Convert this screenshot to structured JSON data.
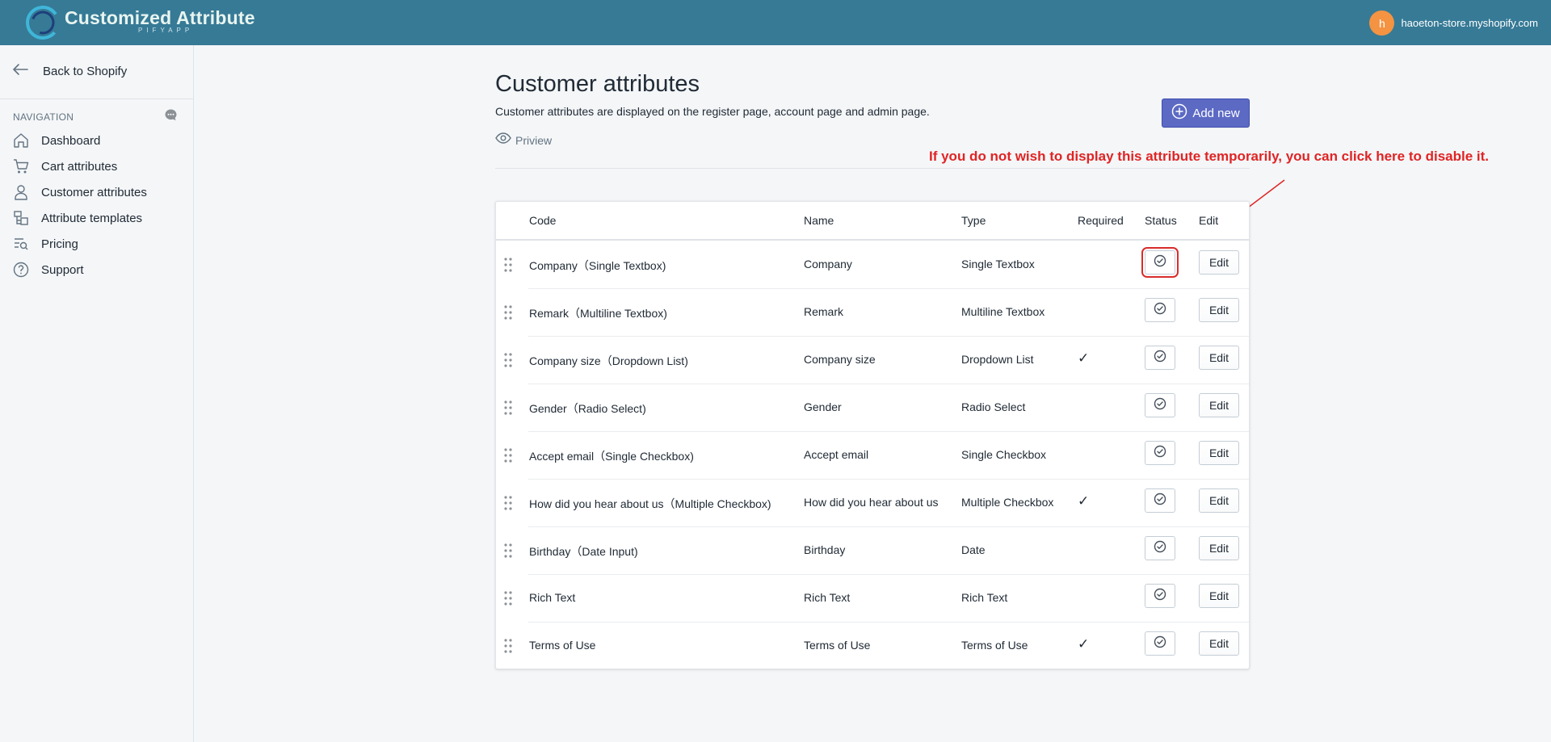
{
  "header": {
    "app_title": "Customized Attribute",
    "app_subtitle": "PIFYAPP",
    "avatar_letter": "h",
    "store_name": "haoeton-store.myshopify.com"
  },
  "sidebar": {
    "back_label": "Back to Shopify",
    "nav_heading": "NAVIGATION",
    "items": [
      {
        "label": "Dashboard",
        "icon": "home-icon"
      },
      {
        "label": "Cart attributes",
        "icon": "cart-icon"
      },
      {
        "label": "Customer attributes",
        "icon": "customer-icon"
      },
      {
        "label": "Attribute templates",
        "icon": "templates-icon"
      },
      {
        "label": "Pricing",
        "icon": "pricing-icon"
      },
      {
        "label": "Support",
        "icon": "help-icon"
      }
    ]
  },
  "main": {
    "title": "Customer attributes",
    "description": "Customer attributes are displayed on the register page, account page and admin page.",
    "preview_label": "Priview",
    "add_new_label": "Add new",
    "annotation": "If you do not wish to display this attribute temporarily, you can click here to disable it."
  },
  "table": {
    "headers": {
      "code": "Code",
      "name": "Name",
      "type": "Type",
      "required": "Required",
      "status": "Status",
      "edit": "Edit"
    },
    "edit_label": "Edit",
    "required_mark": "✓",
    "rows": [
      {
        "code": "Company（Single Textbox)",
        "name": "Company",
        "type": "Single Textbox",
        "required": ""
      },
      {
        "code": "Remark（Multiline Textbox)",
        "name": "Remark",
        "type": "Multiline Textbox",
        "required": ""
      },
      {
        "code": "Company size（Dropdown List)",
        "name": "Company size",
        "type": "Dropdown List",
        "required": "✓"
      },
      {
        "code": "Gender（Radio Select)",
        "name": "Gender",
        "type": "Radio Select",
        "required": ""
      },
      {
        "code": "Accept email（Single Checkbox)",
        "name": "Accept email",
        "type": "Single Checkbox",
        "required": ""
      },
      {
        "code": "How did you hear about us（Multiple Checkbox)",
        "name": "How did you hear about us",
        "type": "Multiple Checkbox",
        "required": "✓"
      },
      {
        "code": "Birthday（Date Input)",
        "name": "Birthday",
        "type": "Date",
        "required": ""
      },
      {
        "code": "Rich Text",
        "name": "Rich Text",
        "type": "Rich Text",
        "required": ""
      },
      {
        "code": "Terms of Use",
        "name": "Terms of Use",
        "type": "Terms of Use",
        "required": "✓"
      }
    ]
  },
  "colors": {
    "topbar": "#367a96",
    "primary_button": "#5c6ac4",
    "annotation": "#e02424",
    "avatar": "#f49342"
  }
}
